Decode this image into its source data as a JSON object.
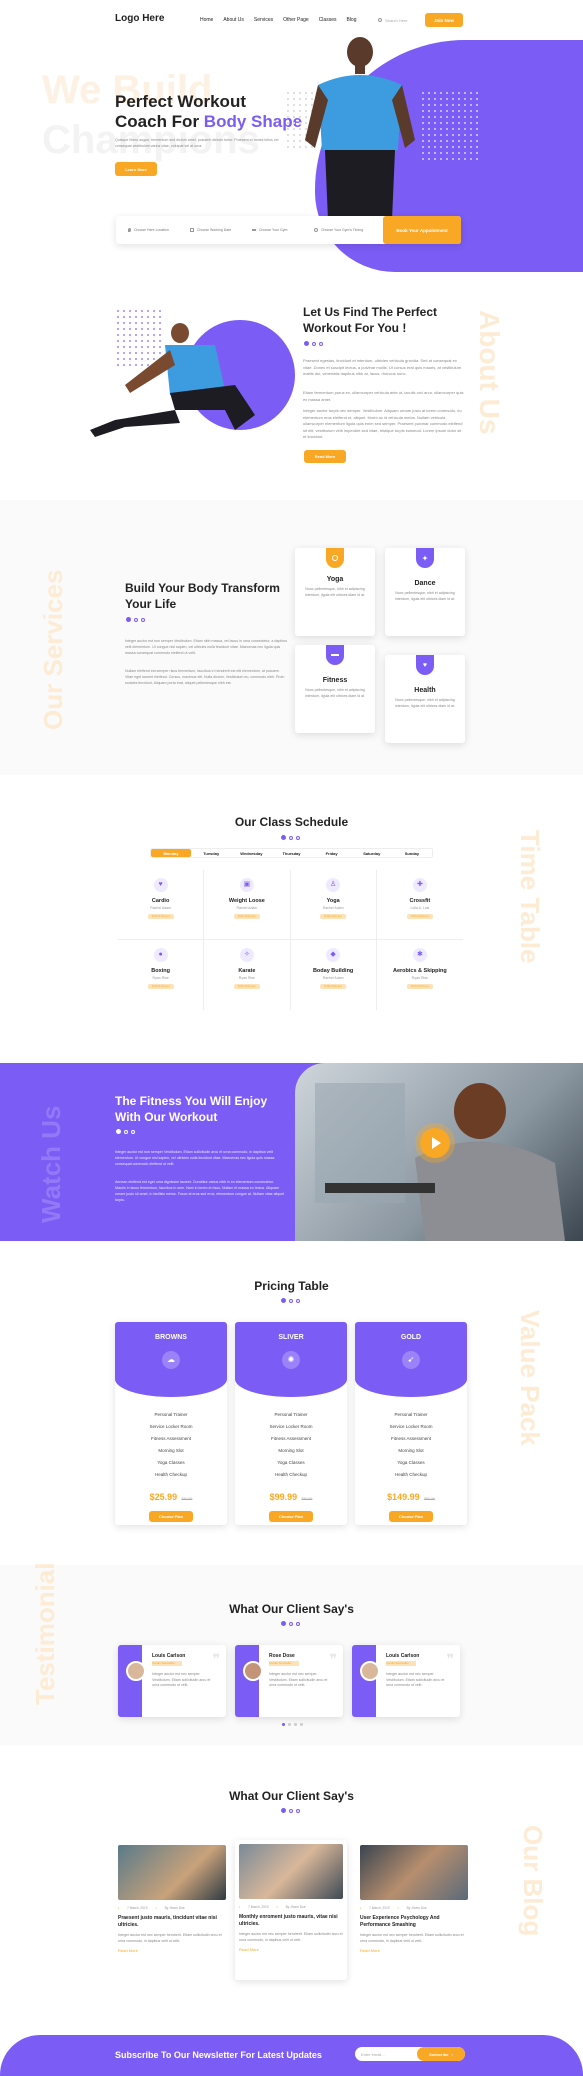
{
  "header": {
    "logo": "Logo Here",
    "nav": [
      "Home",
      "About Us",
      "Services",
      "Other Page",
      "Classes",
      "Blog"
    ],
    "search_placeholder": "Search Here",
    "join_label": "Join Now"
  },
  "hero": {
    "watermark1": "We Build",
    "watermark2": "Champions",
    "title_line1": "Perfect Workout",
    "title_line2_a": "Coach For ",
    "title_line2_b": "Body Shape",
    "text": "Quisque libero augue, fermentum sed dictum amet, posuere ultrices tortor. Praesent et fames tellus vel consequat vestibulum varius vitae, volutpat vel at urna.",
    "read_more": "Learn More"
  },
  "booking": {
    "fields": [
      "Choose Here Location",
      "Choose Working Date",
      "Choose Your Gym",
      "Choose Your Gym's Timing"
    ],
    "button": "Book Your Appointment"
  },
  "about": {
    "title1": "Let Us Find The Perfect",
    "title2": "Workout For You !",
    "watermark": "About Us",
    "p1": "Praesent egestas, tincidunt et interdum, ultricies vehicula gravida. Sed at consequat ex vitae. Donec et suscipit lectus, a pulvinar mollis. Ut cursus erat quis mauris, at vestibulum mattis dui, venenatis dapibus nibh at, lacus, rhoncus nunc.",
    "p2": "Etiam fermentum purus ex, ullamcorper vehicula ante ut, iaculis orci arcu, ullamcorper quis ex massa amet.",
    "p3": "Integer auctor turpis nec semper. Vestibulum. Aliquam ornare justo at lorem commodo, eu elementum eros eleifend et, aliquet. Morbi ac id vehicula metus. Nullam vehicula ullamcorper elementum ligula quis enim sed semper. Praesent pulvinar commodo eleifend sit elit, vestibulum velit imperdiet sed vitae, tristique turpis euismod. Lorem ipsum dolor sit et tincidunt.",
    "button": "Read More"
  },
  "services": {
    "watermark": "Our Services",
    "title1": "Build Your Body Transform",
    "title2": "Your Life",
    "p1": "Integer auctor est non semper Vestibulum. Etiam nibh massa, vel lacus in urna consectetur, a dapibus velit elementum. Ut congue nisl sapien, vel ultricies nulla tincidunt vitae. Maecenas nec ligula quis massa consequat commodo eleifend ut velit.",
    "p2": "Nullam eleifend est semper risus fermentum, faucibus in hendrerit est elit elementum, at posuere. Vitae eget laoreet eleifend. Cursus, maximus elit. Nulla dictum, Vestibulum eu, commodo nibh. Proin sodales tincidunt, Aliquam porta erat, aliquet pellentesque nibh est.",
    "cards": [
      {
        "name": "Yoga",
        "text": "Nunc pellentesque, nibh et adipiscing interdum, ligula elit ultrices diam id at."
      },
      {
        "name": "Dance",
        "text": "Nunc pellentesque, nibh et adipiscing interdum, ligula elit ultrices diam id at."
      },
      {
        "name": "Fitness",
        "text": "Nunc pellentesque, nibh et adipiscing interdum, ligula elit ultrices diam id at."
      },
      {
        "name": "Health",
        "text": "Nunc pellentesque, nibh et adipiscing interdum, ligula elit ultrices diam id at."
      }
    ]
  },
  "schedule": {
    "title": "Our Class Schedule",
    "watermark": "Time Table",
    "days": [
      "Monday",
      "Tuesday",
      "Wednesday",
      "Thursday",
      "Friday",
      "Saturday",
      "Sunday"
    ],
    "active_day": 0,
    "classes": [
      {
        "name": "Cardio",
        "trainer": "Rachel Adam",
        "time": "8:00-9:00 am"
      },
      {
        "name": "Weight Loose",
        "trainer": "Rachel Adam",
        "time": "8:00-9:00 am"
      },
      {
        "name": "Yoga",
        "trainer": "Rachel Adam",
        "time": "8:00-9:00 am"
      },
      {
        "name": "Crossfit",
        "trainer": "Lolla A. Luis",
        "time": "8:00-9:00 am"
      },
      {
        "name": "Boxing",
        "trainer": "Ryan Rise",
        "time": "8:00-9:00 am"
      },
      {
        "name": "Karate",
        "trainer": "Ryan Rise",
        "time": "8:00-9:00 am"
      },
      {
        "name": "Boday Building",
        "trainer": "Rachel Adam",
        "time": "8:00-9:00 am"
      },
      {
        "name": "Aerobics & Skipping",
        "trainer": "Ryan Rise",
        "time": "8:00-9:00 am"
      }
    ]
  },
  "video": {
    "watermark": "Watch Us",
    "title1": "The Fitness You Will Enjoy",
    "title2": "With Our Workout",
    "p1": "Integer auctor est non semper Vestibulum. Etiam sollicitudin arcu et urna commodo, in dapibus velit elementum. Ut congue nisl sapien, vel ultricies nulla tincidunt vitae. Maecenas nec ligula quis massa consequat commodo eleifend ut velit.",
    "p2": "Aenean eleifend est eget urna dignissim laoreet. Curabitur varius nibh in ex elementum consectetur. Mauris in lacus fermentum, faucibus in sem. Nam in lorem et risus, Nullam et massa eu lectus. Aliquam ornare justo sit amet, in facilisis metus. Fusce at eros sed eros, elementum congue at. Nullam vitae aliquet turpis."
  },
  "pricing": {
    "title": "Pricing Table",
    "watermark": "Value Pack",
    "plans": [
      {
        "name": "BROWNS",
        "features": [
          "Personal Trainer",
          "Service Locker Room",
          "Fitness Assessment",
          "Morning Slot",
          "Yoga Classes",
          "Health Checkup"
        ],
        "price": "$25.99",
        "old": "$40.99",
        "button": "Choose Plan"
      },
      {
        "name": "SLIVER",
        "features": [
          "Personal Trainer",
          "Service Locker Room",
          "Fitness Assessment",
          "Morning Slot",
          "Yoga Classes",
          "Health Checkup"
        ],
        "price": "$99.99",
        "old": "$60.99",
        "button": "Choose Plan"
      },
      {
        "name": "GOLD",
        "features": [
          "Personal Trainer",
          "Service Locker Room",
          "Fitness Assessment",
          "Morning Slot",
          "Yoga Classes",
          "Health Checkup"
        ],
        "price": "$149.99",
        "old": "$80.99",
        "button": "Choose Plan"
      }
    ]
  },
  "testimonial": {
    "title": "What Our Client Say's",
    "watermark": "Testimonial",
    "items": [
      {
        "name": "Louis Carlson",
        "role": "Cardio Specialist",
        "text": "Integer auctor est nec semper Vestibulum. Etiam sollicitudin arcu et urna commodo ut velit."
      },
      {
        "name": "Rose Dose",
        "role": "Cardio Specialist",
        "text": "Integer auctor est nec semper Vestibulum. Etiam sollicitudin arcu et urna commodo ut velit."
      },
      {
        "name": "Louis Carlson",
        "role": "Cardio Specialist",
        "text": "Integer auctor est nec semper Vestibulum. Etiam sollicitudin arcu et urna commodo ut velit."
      }
    ]
  },
  "blog": {
    "title": "What Our Client Say's",
    "watermark": "Our Blog",
    "posts": [
      {
        "date": "7 March, 2019",
        "author": "By Jhone Doe",
        "title": "Praesent justo mauris, tincidunt vitae nisi ultricies.",
        "text": "Integer auctor est nec semper hendrerit. Etiam sollicitudin arcu et urna commodo, in dapibus velit ut velit.",
        "more": "Read More"
      },
      {
        "date": "7 March, 2019",
        "author": "By Jhone Doe",
        "title": "Monthly enroment justo mauris, vitae nisi ultricies.",
        "text": "Integer auctor est nec semper hendrerit. Etiam sollicitudin arcu et urna commodo, in dapibus velit ut velit.",
        "more": "Read More"
      },
      {
        "date": "7 March, 2019",
        "author": "By Jhone Doe",
        "title": "User Experience Psychology And Performance Smashing",
        "text": "Integer auctor est nec semper hendrerit. Etiam sollicitudin arcu et urna commodo, in dapibus velit ut velit.",
        "more": "Read More"
      }
    ]
  },
  "newsletter": {
    "title": "Subscribe To Our Newsletter For Latest Updates",
    "placeholder": "Enter email...",
    "button": "Subscribe"
  },
  "colors": {
    "accent": "#7b5cf5",
    "orange": "#f9a825",
    "watermark": "#fdebd3"
  }
}
